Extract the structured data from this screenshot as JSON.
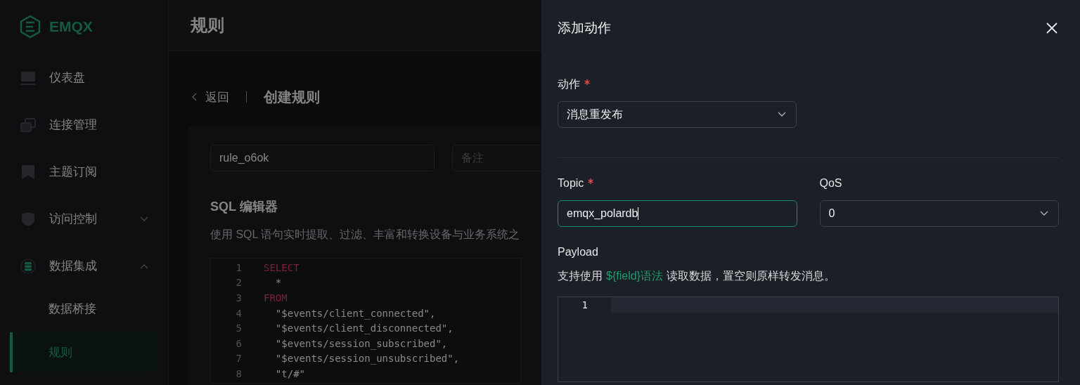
{
  "sidebar": {
    "logo": "EMQX",
    "items": [
      {
        "label": "仪表盘",
        "selected": false
      },
      {
        "label": "连接管理",
        "selected": false
      },
      {
        "label": "主题订阅",
        "selected": false
      },
      {
        "label": "访问控制",
        "selected": false,
        "expanded": false
      },
      {
        "label": "数据集成",
        "selected": false,
        "expanded": true,
        "children": [
          {
            "label": "数据桥接",
            "selected": false
          },
          {
            "label": "规则",
            "selected": true
          }
        ]
      }
    ]
  },
  "header": {
    "title": "规则"
  },
  "breadcrumb": {
    "back": "返回",
    "title": "创建规则"
  },
  "rule_form": {
    "name": {
      "value": "rule_o6ok"
    },
    "note": {
      "placeholder": "备注"
    }
  },
  "sql_editor": {
    "title": "SQL 编辑器",
    "description": "使用 SQL 语句实时提取、过滤、丰富和转换设备与业务系统之",
    "lines": [
      {
        "number": "1",
        "text": "SELECT",
        "kind": "keyword"
      },
      {
        "number": "2",
        "text": "  *",
        "kind": "plain"
      },
      {
        "number": "3",
        "text": "FROM",
        "kind": "keyword"
      },
      {
        "number": "4",
        "text": "  \"$events/client_connected\",",
        "kind": "string"
      },
      {
        "number": "5",
        "text": "  \"$events/client_disconnected\",",
        "kind": "string"
      },
      {
        "number": "6",
        "text": "  \"$events/session_subscribed\",",
        "kind": "string"
      },
      {
        "number": "7",
        "text": "  \"$events/session_unsubscribed\",",
        "kind": "string"
      },
      {
        "number": "8",
        "text": "  \"t/#\"",
        "kind": "string"
      }
    ]
  },
  "drawer": {
    "title": "添加动作",
    "action": {
      "label": "动作",
      "required": true,
      "value": "消息重发布"
    },
    "topic": {
      "label": "Topic",
      "required": true,
      "value": "emqx_polardb"
    },
    "qos": {
      "label": "QoS",
      "value": "0"
    },
    "payload": {
      "label": "Payload",
      "hint_before": "支持使用",
      "hint_link": "${field}语法",
      "hint_after": "读取数据，置空则原样转发消息。",
      "lines": [
        {
          "number": "1"
        }
      ]
    }
  }
}
